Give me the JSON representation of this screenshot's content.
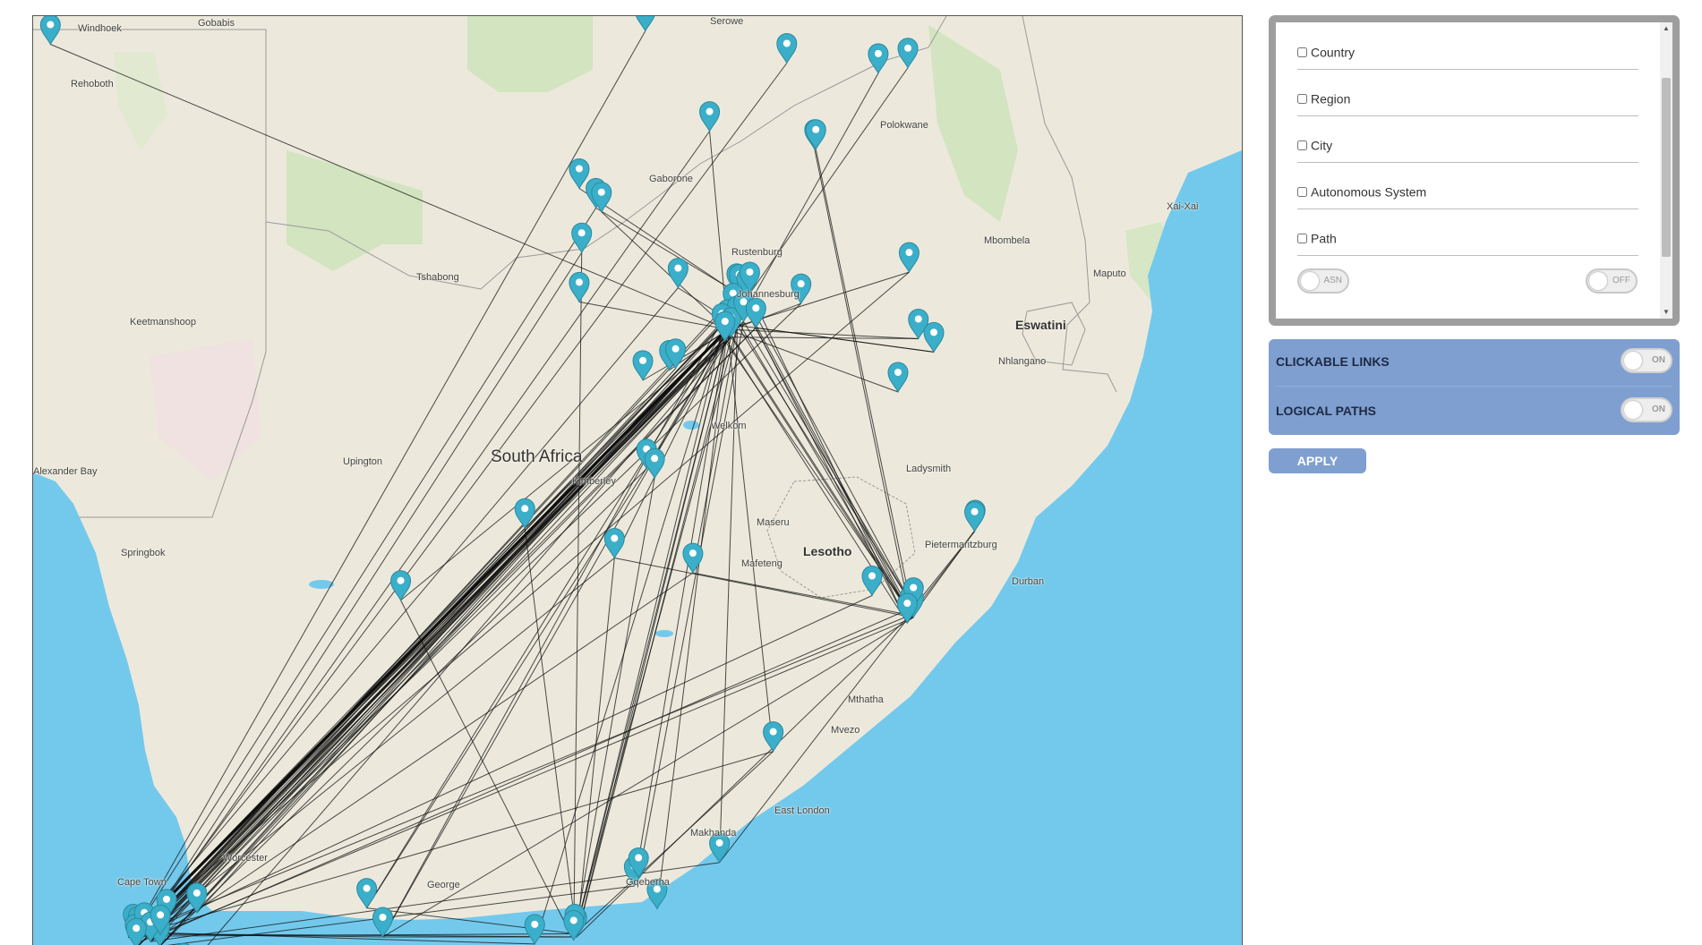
{
  "map": {
    "labels": {
      "country": "South Africa",
      "lesotho": "Lesotho",
      "eswatini": "Eswatini",
      "windhoek": "Windhoek",
      "gobabis": "Gobabis",
      "rehoboth": "Rehoboth",
      "keetmanshoop": "Keetmanshoop",
      "tshabong": "Tshabong",
      "upington": "Upington",
      "alexander_bay": "Alexander Bay",
      "springbok": "Springbok",
      "kimberley": "Kimberley",
      "welkom": "Welkom",
      "maseru": "Maseru",
      "mafeteng": "Mafeteng",
      "bloemfontein": "",
      "serowe": "Serowe",
      "gaborone": "Gaborone",
      "rustenburg": "Rustenburg",
      "johannesburg": "Johannesburg",
      "polokwane": "Polokwane",
      "mbombela": "Mbombela",
      "maputo": "Maputo",
      "xai_xai": "Xai-Xai",
      "nhlangano": "Nhlangano",
      "ladysmith": "Ladysmith",
      "pietermaritzburg": "Pietermaritzburg",
      "durban": "Durban",
      "mthatha": "Mthatha",
      "mvezo": "Mvezo",
      "east_london": "East London",
      "makhanda": "Makhanda",
      "gqeberha": "Gqeberha",
      "george": "George",
      "cape_town": "Cape Town",
      "worcester": "Worcester"
    }
  },
  "filters": {
    "country": "Country",
    "region": "Region",
    "city": "City",
    "autonomous_system": "Autonomous System",
    "path": "Path",
    "asn_toggle": "ASN",
    "off_toggle": "OFF"
  },
  "options": {
    "clickable_links": "CLICKABLE LINKS",
    "clickable_links_toggle": "ON",
    "logical_paths": "LOGICAL PATHS",
    "logical_paths_toggle": "ON"
  },
  "apply_label": "APPLY",
  "colors": {
    "land": "#ece9dc",
    "sea": "#73c9ec",
    "green": "#d0e3bc",
    "marker": "#3bafc9",
    "link": "#111111",
    "panel_blue": "#7f9fd0",
    "panel_grey": "#9e9e9e"
  },
  "icons": {
    "marker": "map-pin-icon",
    "scroll_up": "triangle-up-icon",
    "scroll_down": "triangle-down-icon"
  },
  "network": {
    "nodes": [
      {
        "id": "windhoek",
        "lat": -22.56,
        "lon": 17.08
      },
      {
        "id": "serowe",
        "lat": -22.39,
        "lon": 26.71
      },
      {
        "id": "botswana_e1",
        "lat": -22.8,
        "lon": 29.0
      },
      {
        "id": "limpopo1",
        "lat": -22.93,
        "lon": 30.48
      },
      {
        "id": "limpopo2",
        "lat": -22.86,
        "lon": 30.96
      },
      {
        "id": "limpopo3",
        "lat": -23.9,
        "lon": 29.45
      },
      {
        "id": "polokwane",
        "lat": -23.9,
        "lon": 29.47
      },
      {
        "id": "ellisras",
        "lat": -23.67,
        "lon": 27.75
      },
      {
        "id": "gaborone1",
        "lat": -24.4,
        "lon": 25.64
      },
      {
        "id": "gaborone2",
        "lat": -24.65,
        "lon": 25.91
      },
      {
        "id": "gaborone3",
        "lat": -24.7,
        "lon": 26.0
      },
      {
        "id": "lobatse",
        "lat": -25.22,
        "lon": 25.68
      },
      {
        "id": "mbombela",
        "lat": -25.47,
        "lon": 30.98
      },
      {
        "id": "rustenburg",
        "lat": -25.67,
        "lon": 27.24
      },
      {
        "id": "pretoria1",
        "lat": -25.74,
        "lon": 28.19
      },
      {
        "id": "pretoria2",
        "lat": -25.75,
        "lon": 28.23
      },
      {
        "id": "pretoria3",
        "lat": -25.8,
        "lon": 28.35
      },
      {
        "id": "pretoria4",
        "lat": -25.72,
        "lon": 28.4
      },
      {
        "id": "midrand",
        "lat": -25.99,
        "lon": 28.13
      },
      {
        "id": "jhb1",
        "lat": -26.2,
        "lon": 28.04
      },
      {
        "id": "jhb2",
        "lat": -26.15,
        "lon": 28.2
      },
      {
        "id": "jhb3",
        "lat": -26.25,
        "lon": 27.95
      },
      {
        "id": "jhb4",
        "lat": -26.3,
        "lon": 28.1
      },
      {
        "id": "jhb5",
        "lat": -26.35,
        "lon": 28.0
      },
      {
        "id": "jhb6",
        "lat": -26.1,
        "lon": 28.3
      },
      {
        "id": "kempton",
        "lat": -26.18,
        "lon": 28.5
      },
      {
        "id": "witbank",
        "lat": -25.87,
        "lon": 29.23
      },
      {
        "id": "mbabane",
        "lat": -26.32,
        "lon": 31.13
      },
      {
        "id": "manzini",
        "lat": -26.49,
        "lon": 31.38
      },
      {
        "id": "mahikeng",
        "lat": -25.85,
        "lon": 25.64
      },
      {
        "id": "klerksdorp",
        "lat": -26.85,
        "lon": 26.67
      },
      {
        "id": "potch",
        "lat": -26.72,
        "lon": 27.1
      },
      {
        "id": "potch2",
        "lat": -26.7,
        "lon": 27.2
      },
      {
        "id": "piet_retief",
        "lat": -27.0,
        "lon": 30.8
      },
      {
        "id": "welkom",
        "lat": -27.98,
        "lon": 26.73
      },
      {
        "id": "virginia",
        "lat": -28.1,
        "lon": 26.86
      },
      {
        "id": "kimberley",
        "lat": -28.74,
        "lon": 24.76
      },
      {
        "id": "bloem",
        "lat": -29.12,
        "lon": 26.21
      },
      {
        "id": "maseru",
        "lat": -29.31,
        "lon": 27.48
      },
      {
        "id": "zululand1",
        "lat": -28.76,
        "lon": 32.05
      },
      {
        "id": "richards_bay",
        "lat": -28.78,
        "lon": 32.04
      },
      {
        "id": "pmb",
        "lat": -29.6,
        "lon": 30.38
      },
      {
        "id": "durban1",
        "lat": -29.85,
        "lon": 31.0
      },
      {
        "id": "durban2",
        "lat": -29.88,
        "lon": 31.05
      },
      {
        "id": "durban3",
        "lat": -29.75,
        "lon": 31.05
      },
      {
        "id": "durban4",
        "lat": -29.95,
        "lon": 30.95
      },
      {
        "id": "prieska",
        "lat": -29.66,
        "lon": 22.75
      },
      {
        "id": "mthatha",
        "lat": -31.59,
        "lon": 28.78
      },
      {
        "id": "east_london",
        "lat": -33.01,
        "lon": 27.91
      },
      {
        "id": "makhanda",
        "lat": -33.31,
        "lon": 26.53
      },
      {
        "id": "makhanda2",
        "lat": -33.2,
        "lon": 26.6
      },
      {
        "id": "port_alfred",
        "lat": -33.6,
        "lon": 26.9
      },
      {
        "id": "gqeberha1",
        "lat": -33.96,
        "lon": 25.6
      },
      {
        "id": "gqeberha2",
        "lat": -33.92,
        "lon": 25.57
      },
      {
        "id": "gqeberha3",
        "lat": -34.0,
        "lon": 25.55
      },
      {
        "id": "jeffreys",
        "lat": -34.05,
        "lon": 24.92
      },
      {
        "id": "george",
        "lat": -33.96,
        "lon": 22.46
      },
      {
        "id": "oudtshoorn",
        "lat": -33.59,
        "lon": 22.2
      },
      {
        "id": "paarl",
        "lat": -33.73,
        "lon": 18.96
      },
      {
        "id": "worcester",
        "lat": -33.65,
        "lon": 19.45
      },
      {
        "id": "ct1",
        "lat": -33.92,
        "lon": 18.42
      },
      {
        "id": "ct2",
        "lat": -33.95,
        "lon": 18.5
      },
      {
        "id": "ct3",
        "lat": -34.05,
        "lon": 18.45
      },
      {
        "id": "ct4",
        "lat": -33.9,
        "lon": 18.6
      },
      {
        "id": "ct5",
        "lat": -34.08,
        "lon": 18.85
      },
      {
        "id": "ct6",
        "lat": -34.02,
        "lon": 18.7
      },
      {
        "id": "ct7",
        "lat": -34.1,
        "lon": 18.47
      },
      {
        "id": "stellenbosch",
        "lat": -33.93,
        "lon": 18.86
      },
      {
        "id": "hermanus",
        "lat": -34.42,
        "lon": 19.24
      }
    ],
    "links": [
      [
        "windhoek",
        "jhb1"
      ],
      [
        "serowe",
        "ct1"
      ],
      [
        "botswana_e1",
        "ct2"
      ],
      [
        "limpopo1",
        "jhb2"
      ],
      [
        "limpopo2",
        "jhb3"
      ],
      [
        "limpopo3",
        "durban1"
      ],
      [
        "polokwane",
        "durban2"
      ],
      [
        "ellisras",
        "jhb1"
      ],
      [
        "ellisras",
        "ct3"
      ],
      [
        "gaborone1",
        "pretoria1"
      ],
      [
        "gaborone2",
        "pretoria2"
      ],
      [
        "gaborone3",
        "jhb1"
      ],
      [
        "gaborone2",
        "ct1"
      ],
      [
        "lobatse",
        "ct4"
      ],
      [
        "mbombela",
        "jhb1"
      ],
      [
        "rustenburg",
        "jhb2"
      ],
      [
        "rustenburg",
        "ct1"
      ],
      [
        "pretoria1",
        "durban1"
      ],
      [
        "pretoria2",
        "durban2"
      ],
      [
        "pretoria3",
        "durban3"
      ],
      [
        "pretoria4",
        "durban4"
      ],
      [
        "midrand",
        "durban1"
      ],
      [
        "jhb1",
        "durban2"
      ],
      [
        "jhb2",
        "durban3"
      ],
      [
        "jhb3",
        "durban4"
      ],
      [
        "jhb4",
        "durban1"
      ],
      [
        "jhb5",
        "durban2"
      ],
      [
        "jhb6",
        "durban3"
      ],
      [
        "kempton",
        "durban4"
      ],
      [
        "jhb1",
        "ct1"
      ],
      [
        "jhb1",
        "ct2"
      ],
      [
        "jhb2",
        "ct3"
      ],
      [
        "jhb2",
        "ct4"
      ],
      [
        "jhb3",
        "ct5"
      ],
      [
        "jhb3",
        "ct6"
      ],
      [
        "jhb4",
        "ct7"
      ],
      [
        "jhb4",
        "ct1"
      ],
      [
        "jhb5",
        "ct2"
      ],
      [
        "jhb5",
        "ct3"
      ],
      [
        "jhb6",
        "ct4"
      ],
      [
        "jhb6",
        "ct5"
      ],
      [
        "kempton",
        "ct6"
      ],
      [
        "kempton",
        "ct7"
      ],
      [
        "midrand",
        "ct1"
      ],
      [
        "midrand",
        "ct2"
      ],
      [
        "pretoria1",
        "ct3"
      ],
      [
        "pretoria2",
        "ct4"
      ],
      [
        "pretoria3",
        "ct5"
      ],
      [
        "pretoria4",
        "ct6"
      ],
      [
        "jhb1",
        "stellenbosch"
      ],
      [
        "jhb2",
        "paarl"
      ],
      [
        "jhb3",
        "worcester"
      ],
      [
        "jhb4",
        "hermanus"
      ],
      [
        "jhb1",
        "ct7"
      ],
      [
        "jhb2",
        "ct1"
      ],
      [
        "jhb1",
        "gqeberha1"
      ],
      [
        "jhb2",
        "gqeberha2"
      ],
      [
        "jhb3",
        "gqeberha3"
      ],
      [
        "jhb4",
        "gqeberha1"
      ],
      [
        "jhb5",
        "makhanda"
      ],
      [
        "jhb6",
        "makhanda2"
      ],
      [
        "jhb1",
        "port_alfred"
      ],
      [
        "jhb2",
        "east_london"
      ],
      [
        "jhb3",
        "jeffreys"
      ],
      [
        "pretoria1",
        "gqeberha2"
      ],
      [
        "jhb1",
        "mbabane"
      ],
      [
        "jhb2",
        "manzini"
      ],
      [
        "jhb3",
        "witbank"
      ],
      [
        "jhb4",
        "mbabane"
      ],
      [
        "kempton",
        "manzini"
      ],
      [
        "jhb1",
        "piet_retief"
      ],
      [
        "jhb1",
        "mahikeng"
      ],
      [
        "jhb2",
        "klerksdorp"
      ],
      [
        "jhb1",
        "potch"
      ],
      [
        "jhb1",
        "kimberley"
      ],
      [
        "jhb1",
        "bloem"
      ],
      [
        "jhb2",
        "maseru"
      ],
      [
        "jhb1",
        "welkom"
      ],
      [
        "jhb2",
        "prieska"
      ],
      [
        "jhb1",
        "mthatha"
      ],
      [
        "durban1",
        "ct1"
      ],
      [
        "durban2",
        "ct3"
      ],
      [
        "durban3",
        "stellenbosch"
      ],
      [
        "durban1",
        "gqeberha1"
      ],
      [
        "durban2",
        "george"
      ],
      [
        "durban1",
        "east_london"
      ],
      [
        "durban1",
        "maseru"
      ],
      [
        "durban2",
        "bloem"
      ],
      [
        "durban1",
        "richards_bay"
      ],
      [
        "pmb",
        "ct2"
      ],
      [
        "richards_bay",
        "durban3"
      ],
      [
        "zululand1",
        "durban4"
      ],
      [
        "mthatha",
        "gqeberha2"
      ],
      [
        "mthatha",
        "ct4"
      ],
      [
        "george",
        "ct1"
      ],
      [
        "george",
        "gqeberha1"
      ],
      [
        "george",
        "jhb1"
      ],
      [
        "oudtshoorn",
        "gqeberha2"
      ],
      [
        "oudtshoorn",
        "jhb2"
      ],
      [
        "prieska",
        "gqeberha3"
      ],
      [
        "kimberley",
        "ct2"
      ],
      [
        "bloem",
        "gqeberha1"
      ],
      [
        "bloem",
        "ct3"
      ],
      [
        "welkom",
        "ct5"
      ],
      [
        "virginia",
        "gqeberha2"
      ],
      [
        "maseru",
        "ct6"
      ],
      [
        "gqeberha1",
        "ct1"
      ],
      [
        "gqeberha2",
        "ct2"
      ],
      [
        "jeffreys",
        "ct4"
      ],
      [
        "makhanda",
        "ct5"
      ],
      [
        "east_london",
        "ct6"
      ],
      [
        "lobatse",
        "gqeberha3"
      ],
      [
        "mbombela",
        "ct1"
      ],
      [
        "witbank",
        "ct3"
      ],
      [
        "pretoria1",
        "george"
      ],
      [
        "jhb3",
        "oudtshoorn"
      ],
      [
        "potch2",
        "ct7"
      ],
      [
        "kimberley",
        "gqeberha1"
      ]
    ],
    "bundle": {
      "from": "jhb1",
      "to": "ct1",
      "count": 24
    }
  }
}
